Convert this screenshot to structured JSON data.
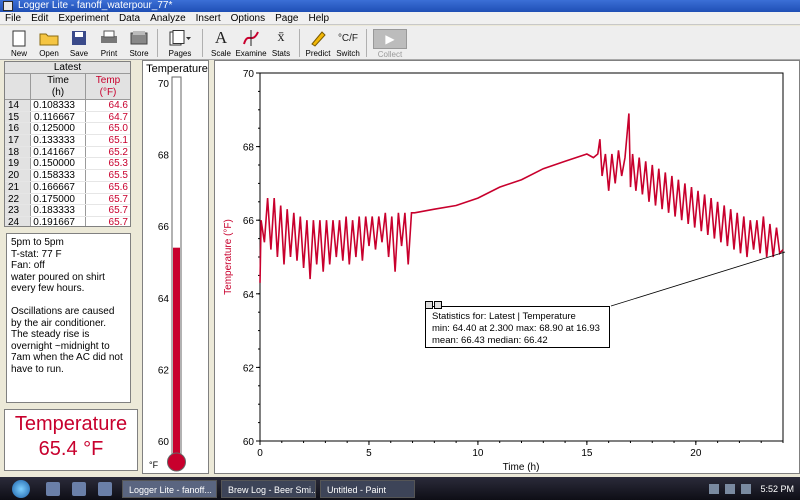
{
  "window": {
    "title": "Logger Lite - fanoff_waterpour_77*"
  },
  "menu": [
    "File",
    "Edit",
    "Experiment",
    "Data",
    "Analyze",
    "Insert",
    "Options",
    "Page",
    "Help"
  ],
  "toolbar": {
    "new": "New",
    "open": "Open",
    "save": "Save",
    "print": "Print",
    "store": "Store",
    "pages": "Pages",
    "scale": "Scale",
    "examine": "Examine",
    "stats": "Stats",
    "predict": "Predict",
    "switch": "Switch",
    "collect": "Collect"
  },
  "table": {
    "group": "Latest",
    "col_time": "Time",
    "col_time_unit": "(h)",
    "col_temp": "Temp",
    "col_temp_unit": "(°F)",
    "rows": [
      {
        "n": "14",
        "t": "0.108333",
        "v": "64.6"
      },
      {
        "n": "15",
        "t": "0.116667",
        "v": "64.7"
      },
      {
        "n": "16",
        "t": "0.125000",
        "v": "65.0"
      },
      {
        "n": "17",
        "t": "0.133333",
        "v": "65.1"
      },
      {
        "n": "18",
        "t": "0.141667",
        "v": "65.2"
      },
      {
        "n": "19",
        "t": "0.150000",
        "v": "65.3"
      },
      {
        "n": "20",
        "t": "0.158333",
        "v": "65.5"
      },
      {
        "n": "21",
        "t": "0.166667",
        "v": "65.6"
      },
      {
        "n": "22",
        "t": "0.175000",
        "v": "65.7"
      },
      {
        "n": "23",
        "t": "0.183333",
        "v": "65.7"
      },
      {
        "n": "24",
        "t": "0.191667",
        "v": "65.7"
      }
    ]
  },
  "notes": "5pm to 5pm\nT-stat: 77 F\nFan: off\nwater poured on shirt every few hours.\n\nOscillations are caused by the air conditioner.  The steady rise is overnight ~midnight to 7am when the AC did not have to run.",
  "meter": {
    "name": "Temperature",
    "value": "65.4 °F"
  },
  "thermometer": {
    "title": "Temperature",
    "unit": "°F",
    "ticks": [
      "70",
      "68",
      "66",
      "64",
      "62",
      "60"
    ],
    "level": 65.4,
    "min": 60,
    "max": 70
  },
  "stats": {
    "title": "Statistics for: Latest | Temperature",
    "line2": "min: 64.40 at 2.300 max: 68.90 at 16.93",
    "line3": "mean: 66.43 median: 66.42"
  },
  "taskbar": {
    "items": [
      "Logger Lite - fanoff...",
      "Brew Log - Beer Smi...",
      "Untitled - Paint"
    ],
    "time": "5:52 PM"
  },
  "colors": {
    "series": "#c8002d",
    "titlebar": "#2a5cc4"
  },
  "chart_data": {
    "type": "line",
    "xlabel": "Time (h)",
    "ylabel": "Temperature (°F)",
    "xlim": [
      0,
      24
    ],
    "ylim": [
      60,
      70
    ],
    "xticks": [
      "0",
      "5",
      "10",
      "15",
      "20"
    ],
    "yticks": [
      "60",
      "62",
      "64",
      "66",
      "68",
      "70"
    ],
    "grid": false,
    "series": [
      {
        "name": "Temperature",
        "x": [
          0,
          0.05,
          0.2,
          0.35,
          0.5,
          0.65,
          0.8,
          0.95,
          1.1,
          1.25,
          1.4,
          1.55,
          1.7,
          1.85,
          2.0,
          2.15,
          2.3,
          2.45,
          2.6,
          2.75,
          2.9,
          3.05,
          3.2,
          3.35,
          3.5,
          3.65,
          3.8,
          3.95,
          4.1,
          4.25,
          4.4,
          4.55,
          4.7,
          4.85,
          5.0,
          5.15,
          5.3,
          5.45,
          5.6,
          5.75,
          5.9,
          6.05,
          6.2,
          6.35,
          6.5,
          6.65,
          6.8,
          6.95,
          7.1,
          8.0,
          9.0,
          10.0,
          11.0,
          12.0,
          13.0,
          14.0,
          15.0,
          15.3,
          15.5,
          15.6,
          15.7,
          15.85,
          16.0,
          16.15,
          16.3,
          16.45,
          16.6,
          16.75,
          16.93,
          17.0,
          17.1,
          17.25,
          17.4,
          17.55,
          17.7,
          17.85,
          18.0,
          18.15,
          18.3,
          18.45,
          18.6,
          18.75,
          18.9,
          19.05,
          19.2,
          19.35,
          19.5,
          19.65,
          19.8,
          19.95,
          20.1,
          20.25,
          20.4,
          20.55,
          20.7,
          20.85,
          21.0,
          21.15,
          21.3,
          21.45,
          21.6,
          21.75,
          21.9,
          22.05,
          22.2,
          22.35,
          22.5,
          22.65,
          22.8,
          22.95,
          23.1,
          23.25,
          23.4,
          23.55,
          23.7,
          23.85,
          24.0
        ],
        "y": [
          64.3,
          66.0,
          65.4,
          66.6,
          65.2,
          66.6,
          65.0,
          66.4,
          64.8,
          66.3,
          65.0,
          66.2,
          64.9,
          66.1,
          64.7,
          66.0,
          64.4,
          66.0,
          64.8,
          66.0,
          64.6,
          66.0,
          64.8,
          66.0,
          65.0,
          66.0,
          64.9,
          66.1,
          64.8,
          66.0,
          65.0,
          66.1,
          64.9,
          66.1,
          65.3,
          66.1,
          65.2,
          66.1,
          65.4,
          66.2,
          65.0,
          66.1,
          64.6,
          66.2,
          65.3,
          66.2,
          64.8,
          66.2,
          66.2,
          66.3,
          66.4,
          66.6,
          66.9,
          67.1,
          67.4,
          67.6,
          67.8,
          67.7,
          67.8,
          68.2,
          67.2,
          67.8,
          66.8,
          67.8,
          67.0,
          67.9,
          67.2,
          67.7,
          68.9,
          66.9,
          67.8,
          66.8,
          67.7,
          66.7,
          67.6,
          66.5,
          67.5,
          66.4,
          67.4,
          66.3,
          67.3,
          66.2,
          67.2,
          66.1,
          67.1,
          66.0,
          67.0,
          65.9,
          66.9,
          65.8,
          66.8,
          65.7,
          66.7,
          65.6,
          66.6,
          65.5,
          66.5,
          65.4,
          66.4,
          65.3,
          66.3,
          65.2,
          66.2,
          65.1,
          66.1,
          65.0,
          66.0,
          65.2,
          66.0,
          65.1,
          66.1,
          65.0,
          65.9,
          65.0,
          65.8,
          65.1,
          65.2
        ]
      }
    ]
  }
}
